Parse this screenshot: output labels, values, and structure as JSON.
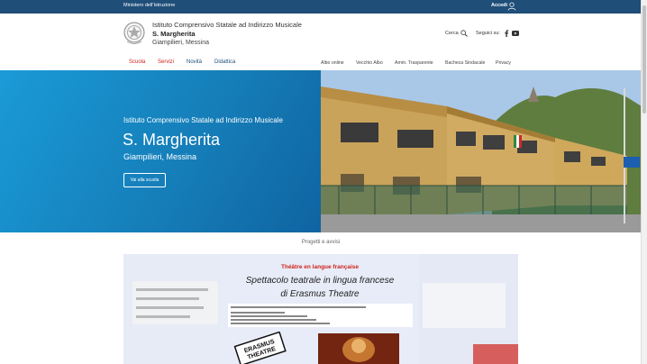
{
  "topbar": {
    "ministry": "Ministero dell'Istruzione",
    "login": "Accedi"
  },
  "header": {
    "line1": "Istituto Comprensivo Statale ad Indirizzo Musicale",
    "line2": "S. Margherita",
    "line3": "Giampilieri, Messina",
    "search_label": "Cerca",
    "follow_label": "Seguici su:"
  },
  "nav": {
    "main": [
      {
        "label": "Scuola",
        "color": "#d0231c"
      },
      {
        "label": "Servizi",
        "color": "#d0231c"
      },
      {
        "label": "Novità",
        "color": "#1f4e79"
      },
      {
        "label": "Didattica",
        "color": "#1f4e79"
      }
    ],
    "secondary": [
      "Albo online",
      "Vecchio Albo",
      "Amm. Trasparente",
      "Bacheca Sindacale",
      "Privacy"
    ]
  },
  "hero": {
    "subtitle": "Istituto Comprensivo Statale ad Indirizzo Musicale",
    "name": "S. Margherita",
    "city": "Giampilieri, Messina",
    "button": "Vai alla scuola"
  },
  "projects": {
    "title": "Progetti e avvisi"
  },
  "poster": {
    "title": "Théâtre en langue française",
    "line1": "Spettacolo teatrale in lingua francese",
    "line2": "di Erasmus Theatre",
    "logo_text": "ERASMUS THEATRE"
  },
  "colors": {
    "topbar": "#1f4e79",
    "accent_red": "#d0231c",
    "hero_blue": "#157cb7"
  }
}
